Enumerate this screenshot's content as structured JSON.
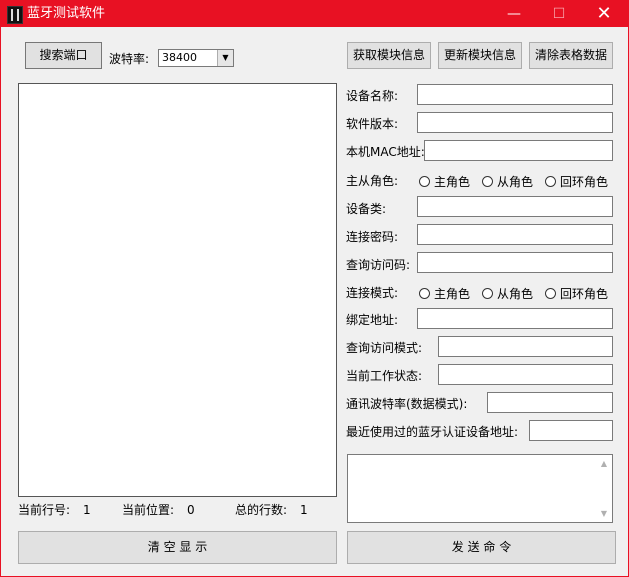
{
  "window": {
    "title": "蓝牙测试软件",
    "title_color": "#e81123"
  },
  "titlebar": {
    "minimize_icon": "minimize-icon",
    "maximize_icon": "maximize-icon",
    "close_icon": "close-icon",
    "minimize_glyph": "—",
    "maximize_glyph": "☐",
    "close_glyph": "✕"
  },
  "toolbar": {
    "search_port_label": "搜索端口",
    "baud_label": "波特率:",
    "baud_value": "38400",
    "combo_arrow": "▼",
    "get_info_label": "获取模块信息",
    "update_info_label": "更新模块信息",
    "clear_table_label": "清除表格数据"
  },
  "form": {
    "device_name_label": "设备名称:",
    "device_name_value": "",
    "software_version_label": "软件版本:",
    "software_version_value": "",
    "local_mac_label": "本机MAC地址:",
    "local_mac_value": "",
    "role_label": "主从角色:",
    "role_options": [
      "主角色",
      "从角色",
      "回环角色"
    ],
    "device_class_label": "设备类:",
    "device_class_value": "",
    "pair_password_label": "连接密码:",
    "pair_password_value": "",
    "inquiry_access_code_label": "查询访问码:",
    "inquiry_access_code_value": "",
    "connect_mode_label": "连接模式:",
    "connect_mode_options": [
      "主角色",
      "从角色",
      "回环角色"
    ],
    "bind_address_label": "绑定地址:",
    "bind_address_value": "",
    "inquiry_access_mode_label": "查询访问模式:",
    "inquiry_access_mode_value": "",
    "work_state_label": "当前工作状态:",
    "work_state_value": "",
    "comm_baud_label": "通讯波特率(数据模式):",
    "comm_baud_value": "",
    "recent_device_label": "最近使用过的蓝牙认证设备地址:",
    "recent_device_value": ""
  },
  "status": {
    "current_line_label": "当前行号:",
    "current_line_value": "1",
    "current_pos_label": "当前位置:",
    "current_pos_value": "0",
    "total_lines_label": "总的行数:",
    "total_lines_value": "1"
  },
  "actions": {
    "clear_display_label": "清 空 显 示",
    "send_command_label": "发 送 命 令"
  },
  "scrollbar": {
    "up_glyph": "▲",
    "down_glyph": "▼"
  }
}
